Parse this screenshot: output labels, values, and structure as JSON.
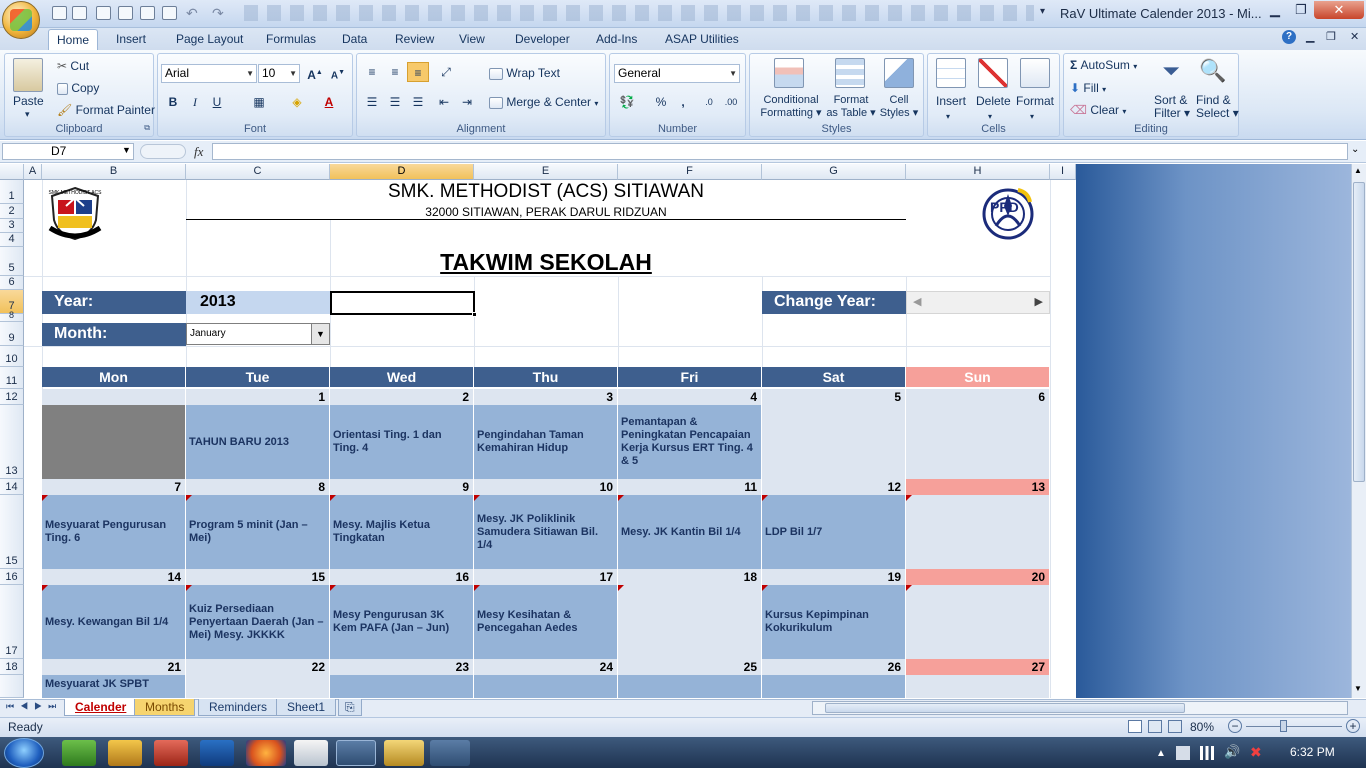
{
  "window": {
    "title": "RaV Ultimate Calender 2013 - Mi..."
  },
  "ribbon_tabs": [
    "Home",
    "Insert",
    "Page Layout",
    "Formulas",
    "Data",
    "Review",
    "View",
    "Developer",
    "Add-Ins",
    "ASAP Utilities"
  ],
  "clipboard": {
    "paste": "Paste",
    "cut": "Cut",
    "copy": "Copy",
    "format_painter": "Format Painter",
    "label": "Clipboard"
  },
  "font": {
    "name": "Arial",
    "size": "10",
    "label": "Font"
  },
  "alignment": {
    "wrap": "Wrap Text",
    "merge": "Merge & Center",
    "label": "Alignment"
  },
  "number": {
    "format": "General",
    "label": "Number"
  },
  "styles": {
    "conditional": "Conditional",
    "conditional2": "Formatting",
    "format_table": "Format",
    "format_table2": "as Table",
    "cell_styles": "Cell",
    "cell_styles2": "Styles",
    "label": "Styles"
  },
  "cells": {
    "insert": "Insert",
    "delete": "Delete",
    "format": "Format",
    "label": "Cells"
  },
  "editing": {
    "autosum": "AutoSum",
    "fill": "Fill",
    "clear": "Clear",
    "sort": "Sort &",
    "sort2": "Filter",
    "find": "Find &",
    "find2": "Select",
    "label": "Editing"
  },
  "formula_bar": {
    "name_box": "D7",
    "fx": "fx",
    "value": ""
  },
  "columns": [
    "A",
    "B",
    "C",
    "D",
    "E",
    "F",
    "G",
    "H",
    "I"
  ],
  "rows": [
    "1",
    "2",
    "3",
    "4",
    "5",
    "6",
    "7",
    "8",
    "9",
    "10",
    "11",
    "12",
    "13",
    "14",
    "15",
    "16",
    "17",
    "18"
  ],
  "sheet": {
    "school_name": "SMK. METHODIST (ACS) SITIAWAN",
    "address": "32000 SITIAWAN, PERAK DARUL RIDZUAN",
    "heading": "TAKWIM SEKOLAH",
    "year_label": "Year:",
    "year_value": "2013",
    "change_year_label": "Change Year:",
    "month_label": "Month:",
    "month_value": "January",
    "logo_left_text": "SMK METHODIST ACS",
    "logo_right_text": "PPD"
  },
  "days": [
    "Mon",
    "Tue",
    "Wed",
    "Thu",
    "Fri",
    "Sat",
    "Sun"
  ],
  "weeks": [
    {
      "nums": [
        "",
        "1",
        "2",
        "3",
        "4",
        "5",
        "6"
      ],
      "events": [
        "",
        "TAHUN BARU 2013",
        "Orientasi Ting. 1 dan Ting. 4",
        "Pengindahan Taman Kemahiran Hidup",
        "Pemantapan & Peningkatan Pencapaian Kerja Kursus ERT Ting. 4 & 5",
        "",
        ""
      ]
    },
    {
      "nums": [
        "7",
        "8",
        "9",
        "10",
        "11",
        "12",
        "13"
      ],
      "events": [
        "Mesyuarat Pengurusan Ting. 6",
        "Program 5 minit (Jan – Mei)",
        "Mesy. Majlis Ketua Tingkatan",
        "Mesy. JK Poliklinik Samudera Sitiawan Bil. 1/4",
        "Mesy. JK Kantin Bil 1/4",
        "LDP Bil 1/7",
        ""
      ]
    },
    {
      "nums": [
        "14",
        "15",
        "16",
        "17",
        "18",
        "19",
        "20"
      ],
      "events": [
        "Mesy. Kewangan Bil 1/4",
        "Kuiz Persediaan Penyertaan Daerah (Jan – Mei)      Mesy. JKKKK",
        "Mesy Pengurusan 3K Kem PAFA (Jan – Jun)",
        "Mesy Kesihatan & Pencegahan Aedes",
        "",
        "Kursus Kepimpinan Kokurikulum",
        ""
      ]
    },
    {
      "nums": [
        "21",
        "22",
        "23",
        "24",
        "25",
        "26",
        "27"
      ],
      "events": [
        "Mesyuarat JK SPBT",
        "",
        "",
        "",
        "",
        "",
        ""
      ]
    }
  ],
  "sheet_tabs": [
    "Calender",
    "Months",
    "Reminders",
    "Sheet1"
  ],
  "status": {
    "ready": "Ready",
    "zoom": "80%"
  },
  "clock": "6:32 PM",
  "colors": {
    "band": "#3e5f8e",
    "event": "#95b3d7",
    "sunday": "#f6a09a",
    "pale": "#dde5f0"
  }
}
